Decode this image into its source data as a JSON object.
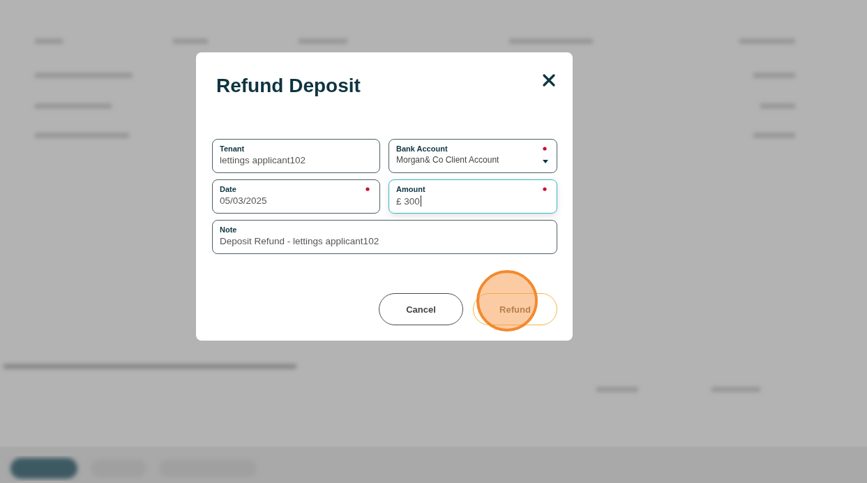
{
  "dialog": {
    "title": "Refund Deposit",
    "fields": [
      {
        "label": "Tenant",
        "value": "lettings applicant102",
        "kind": "text",
        "required": false,
        "focused": false,
        "wide": false
      },
      {
        "label": "Bank Account",
        "value": "Morgan& Co Client Account",
        "kind": "select",
        "required": true,
        "focused": false,
        "wide": false
      },
      {
        "label": "Date",
        "value": "05/03/2025",
        "kind": "text",
        "required": true,
        "focused": false,
        "wide": false
      },
      {
        "label": "Amount",
        "value": "£ 300",
        "kind": "text",
        "required": true,
        "focused": true,
        "wide": false
      },
      {
        "label": "Note",
        "value": "Deposit Refund - lettings applicant102",
        "kind": "text",
        "required": false,
        "focused": false,
        "wide": true
      }
    ],
    "buttons": [
      {
        "label": "Cancel",
        "kind": "secondary",
        "highlighted": false
      },
      {
        "label": "Refund",
        "kind": "primary",
        "highlighted": true
      }
    ]
  }
}
